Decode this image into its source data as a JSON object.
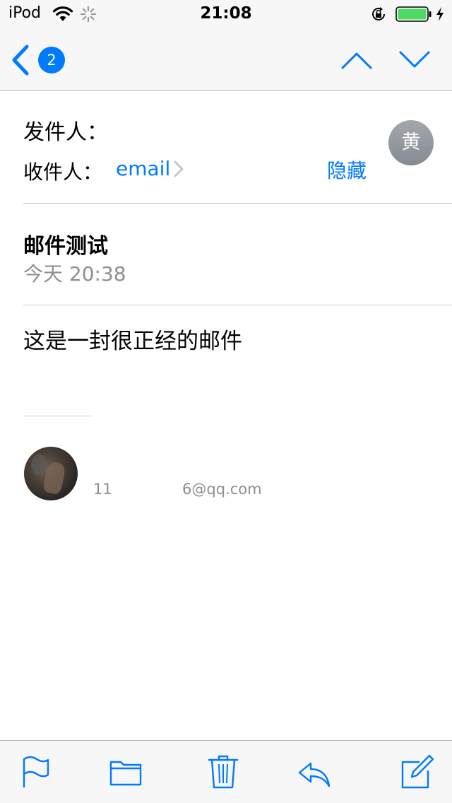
{
  "status_bar": {
    "carrier": "iPod",
    "time": "21:08",
    "icons": [
      "wifi-icon",
      "activity-spinner-icon",
      "orientation-lock-icon",
      "battery-icon",
      "charging-bolt-icon"
    ],
    "battery_color": "#4cd964"
  },
  "nav": {
    "back_badge_count": "2",
    "icons": [
      "chevron-left-icon",
      "chevron-up-icon",
      "chevron-down-icon"
    ]
  },
  "header": {
    "from_label": "发件人：",
    "to_label": "收件人：",
    "to_value": "email",
    "hide_label": "隐藏",
    "sender_initial": "黄"
  },
  "message": {
    "subject": "邮件测试",
    "date": "今天 20:38",
    "body": "这是一封很正经的邮件"
  },
  "signature": {
    "name": "11",
    "email": "6@qq.com"
  },
  "toolbar": {
    "icons": [
      "flag-icon",
      "folder-icon",
      "trash-icon",
      "reply-icon",
      "compose-icon"
    ]
  },
  "colors": {
    "accent": "#007aff",
    "secondary_text": "#8e8e93",
    "bar_background": "#f7f7f7"
  }
}
